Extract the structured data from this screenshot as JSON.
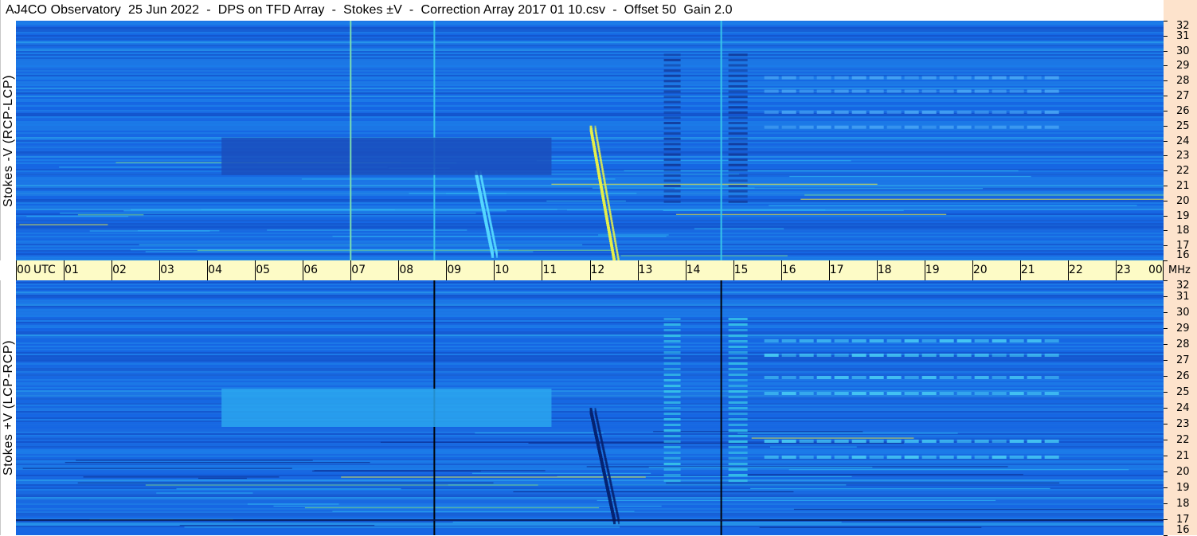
{
  "window": {
    "title": "AJ4CO Observatory  25 Jun 2022  -  DPS on TFD Array  -  Stokes ±V  -  Correction Array 2017 01 10.csv  -  Offset 50  Gain 2.0"
  },
  "chart_data": [
    {
      "type": "heatmap",
      "panel": "top",
      "title": "",
      "ylabel": "Stokes -V (RCP-LCP)",
      "xlabel": "UTC",
      "x_ticks": [
        "00",
        "01",
        "02",
        "03",
        "04",
        "05",
        "06",
        "07",
        "08",
        "09",
        "10",
        "11",
        "12",
        "13",
        "14",
        "15",
        "16",
        "17",
        "18",
        "19",
        "20",
        "21",
        "22",
        "23",
        "00"
      ],
      "xlim": [
        0,
        24
      ],
      "y_unit": "MHz",
      "y_ticks": [
        "16",
        "17",
        "18",
        "19",
        "20",
        "21",
        "22",
        "23",
        "24",
        "25",
        "26",
        "27",
        "28",
        "29",
        "30",
        "31",
        "32"
      ],
      "ylim": [
        16,
        32
      ],
      "colormap": [
        "#0a2a8a",
        "#0b3fbf",
        "#0f5ee6",
        "#1a86f0",
        "#2fb6f2",
        "#7fe08a",
        "#f2ef3a",
        "#ff5a2a"
      ],
      "base_color": "#1d6fe0",
      "features": [
        {
          "kind": "vertical-line",
          "x": 8.75,
          "color": "#38c7ea"
        },
        {
          "kind": "vertical-line",
          "x": 14.75,
          "color": "#38c7ea"
        },
        {
          "kind": "burst",
          "x_start": 12.0,
          "x_end": 12.5,
          "f_high": 25,
          "f_low": 16,
          "color": "#e6f04a"
        },
        {
          "kind": "burst",
          "x_start": 9.6,
          "x_end": 9.95,
          "f_high": 22,
          "f_low": 16.5,
          "color": "#55d7ff"
        },
        {
          "kind": "dark-region",
          "x_start": 4.3,
          "x_end": 11.2,
          "f_low": 21.7,
          "f_high": 24.2,
          "color": "#1a4fbd"
        },
        {
          "kind": "dark-band",
          "x_start": 13.55,
          "x_end": 13.9,
          "f_low": 20,
          "f_high": 30,
          "color": "#123a9a"
        },
        {
          "kind": "dark-band",
          "x_start": 14.9,
          "x_end": 15.3,
          "f_low": 20,
          "f_high": 30,
          "color": "#123a9a"
        },
        {
          "kind": "emission-lines",
          "x_start": 15.65,
          "x_end": 21.7,
          "freqs": [
            25.0,
            26.0,
            27.4,
            28.3
          ],
          "color": "#4aa8f5"
        },
        {
          "kind": "vertical-line",
          "x": 7.0,
          "color": "#7fe0b0"
        }
      ]
    },
    {
      "type": "heatmap",
      "panel": "bottom",
      "title": "",
      "ylabel": "Stokes +V (LCP-RCP)",
      "xlabel": "UTC",
      "x_ticks": [
        "00",
        "01",
        "02",
        "03",
        "04",
        "05",
        "06",
        "07",
        "08",
        "09",
        "10",
        "11",
        "12",
        "13",
        "14",
        "15",
        "16",
        "17",
        "18",
        "19",
        "20",
        "21",
        "22",
        "23",
        "00"
      ],
      "xlim": [
        0,
        24
      ],
      "y_unit": "MHz",
      "y_ticks": [
        "16",
        "17",
        "18",
        "19",
        "20",
        "21",
        "22",
        "23",
        "24",
        "25",
        "26",
        "27",
        "28",
        "29",
        "30",
        "31",
        "32"
      ],
      "ylim": [
        16,
        32
      ],
      "colormap": [
        "#0a2a8a",
        "#0b3fbf",
        "#0f5ee6",
        "#1a86f0",
        "#2fb6f2",
        "#7fe08a",
        "#f2ef3a",
        "#ff5a2a"
      ],
      "base_color": "#1d6fe0",
      "features": [
        {
          "kind": "vertical-line",
          "x": 8.75,
          "color": "#000000"
        },
        {
          "kind": "vertical-line",
          "x": 14.75,
          "color": "#000000"
        },
        {
          "kind": "burst",
          "x_start": 12.0,
          "x_end": 12.5,
          "f_high": 24,
          "f_low": 17,
          "color": "#062372"
        },
        {
          "kind": "bright-region",
          "x_start": 4.3,
          "x_end": 11.2,
          "f_low": 22.8,
          "f_high": 25.2,
          "color": "#2aa6ef"
        },
        {
          "kind": "bright-band",
          "x_start": 13.55,
          "x_end": 13.9,
          "f_low": 19.5,
          "f_high": 30,
          "color": "#36c2e8"
        },
        {
          "kind": "bright-band",
          "x_start": 14.9,
          "x_end": 15.3,
          "f_low": 19.5,
          "f_high": 30,
          "color": "#36c2e8"
        },
        {
          "kind": "emission-lines",
          "x_start": 15.65,
          "x_end": 21.7,
          "freqs": [
            21.0,
            22.0,
            25.0,
            26.0,
            27.4,
            28.3
          ],
          "color": "#4ad0f5"
        },
        {
          "kind": "dark-line",
          "x_start": 0,
          "x_end": 24,
          "f": 17.0,
          "color": "#07154f"
        }
      ]
    }
  ]
}
